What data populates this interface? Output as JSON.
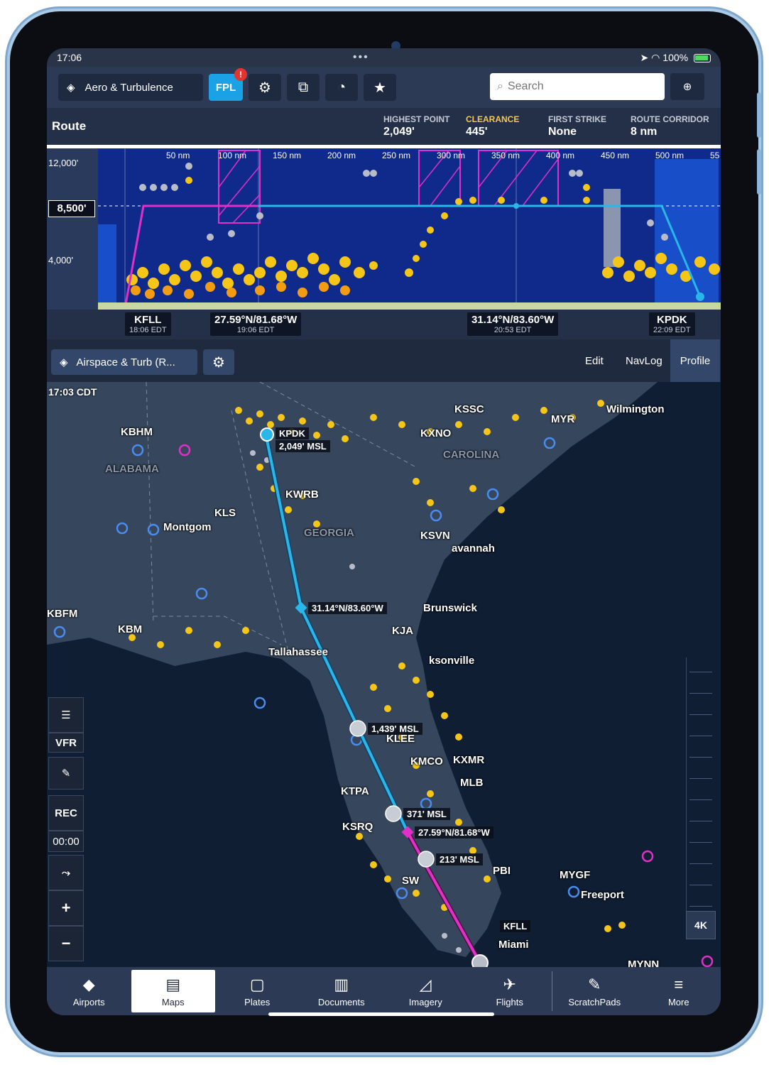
{
  "status": {
    "time": "17:06",
    "battery": "100%"
  },
  "toolbar": {
    "layer_label": "Aero & Turbulence",
    "fpl_label": "FPL",
    "fpl_badge": "!",
    "search_placeholder": "Search"
  },
  "route": {
    "title": "Route",
    "stats": [
      {
        "label": "HIGHEST POINT",
        "value": "2,049'"
      },
      {
        "label": "CLEARANCE",
        "value": "445'"
      },
      {
        "label": "FIRST STRIKE",
        "value": "None"
      },
      {
        "label": "ROUTE CORRIDOR",
        "value": "8 nm"
      }
    ]
  },
  "profile": {
    "alt_top": "12,000'",
    "alt_cruise": "8,500'",
    "alt_low": "4,000'",
    "distances": [
      "50 nm",
      "100 nm",
      "150 nm",
      "200 nm",
      "250 nm",
      "300 nm",
      "350 nm",
      "400 nm",
      "450 nm",
      "500 nm",
      "55"
    ]
  },
  "waypoints": [
    {
      "name": "KFLL",
      "time": "18:06 EDT"
    },
    {
      "name": "27.59°N/81.68°W",
      "time": "19:06 EDT"
    },
    {
      "name": "31.14°N/83.60°W",
      "time": "20:53 EDT"
    },
    {
      "name": "KPDK",
      "time": "22:09 EDT"
    }
  ],
  "mapbar": {
    "layer_label": "Airspace & Turb (R...",
    "tabs": [
      "Edit",
      "NavLog",
      "Profile"
    ]
  },
  "map": {
    "time": "17:03 CDT",
    "labels": {
      "kbhm": "KBHM",
      "alabama": "ALABAMA",
      "kpdk": "KPDK",
      "msl1": "2,049' MSL",
      "kxno": "KXNO",
      "carolina": "CAROLINA",
      "kssc": "KSSC",
      "wilmington": "Wilmington",
      "kwrb": "KWRB",
      "kls": "KLS",
      "montgomery": "Montgom",
      "georgia": "GEORGIA",
      "ksvn": "KSVN",
      "savannah": "avannah",
      "brunswick": "Brunswick",
      "midpt": "31.14°N/83.60°W",
      "kbfm": "KBFM",
      "tallahassee": "Tallahassee",
      "kjax": "KJA",
      "jacksonville": "ksonville",
      "msl2": "1,439' MSL",
      "klee": "KLEE",
      "kmco": "KMCO",
      "kxmr": "KXMR",
      "mlb": "MLB",
      "ktpa": "KTPA",
      "msl3": "371' MSL",
      "ksrq": "KSRQ",
      "waypt": "27.59°N/81.68°W",
      "msl4": "213' MSL",
      "sw": "SW",
      "kfll": "KFLL",
      "miami": "Miami",
      "mygf": "MYGF",
      "freeport": "Freeport",
      "mynn": "MYNN",
      "kbm": "KBM",
      "kmyr": "MYR",
      "kpbi": "PBI"
    },
    "tools": {
      "vfr": "VFR",
      "rec": "REC",
      "rec_time": "00:00",
      "zoom_in": "+",
      "zoom_out": "−",
      "res": "4K"
    }
  },
  "tabs": [
    "Airports",
    "Maps",
    "Plates",
    "Documents",
    "Imagery",
    "Flights",
    "ScratchPads",
    "More"
  ],
  "colors": {
    "accent": "#1aa1e6",
    "route_blue": "#29b6e8",
    "route_magenta": "#e030c8",
    "traffic_yellow": "#f5c518",
    "traffic_orange": "#f39c12"
  }
}
